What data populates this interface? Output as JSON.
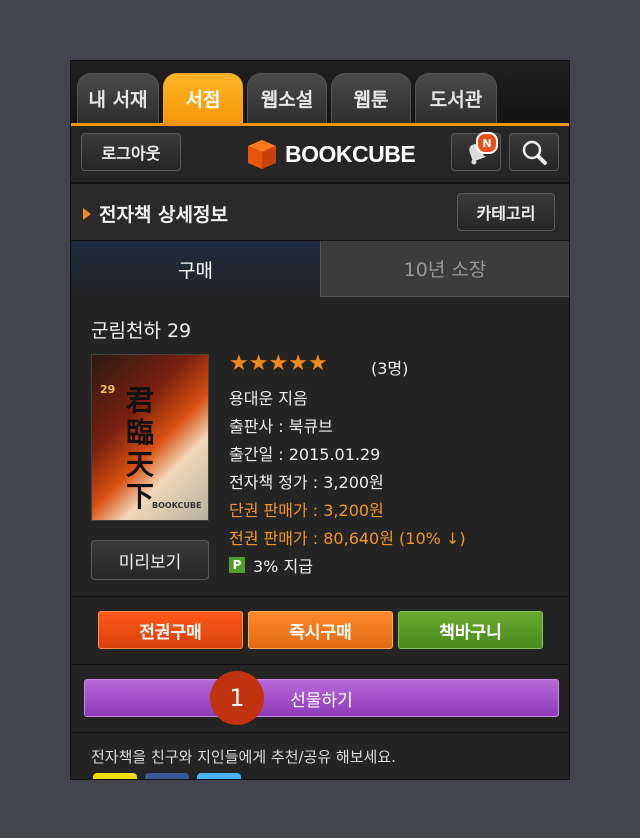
{
  "tabs": [
    {
      "label": "내 서재",
      "active": false
    },
    {
      "label": "서점",
      "active": true
    },
    {
      "label": "웹소설",
      "active": false
    },
    {
      "label": "웹툰",
      "active": false
    },
    {
      "label": "도서관",
      "active": false
    }
  ],
  "header": {
    "logout_label": "로그아웃",
    "logo_text": "BOOKCUBE",
    "notification_badge": "N"
  },
  "section": {
    "title": "전자책 상세정보",
    "category_label": "카테고리"
  },
  "purchase_tabs": [
    {
      "label": "구매",
      "active": true
    },
    {
      "label": "10년 소장",
      "active": false
    }
  ],
  "book": {
    "title": "군림천하 29",
    "rating_stars": 5,
    "rating_count": "(3명)",
    "author": "용대운 지음",
    "publisher": "출판사 : 북큐브",
    "release_date": "출간일 : 2015.01.29",
    "ebook_price": "전자책 정가 : 3,200원",
    "single_price": "단권 판매가 : 3,200원",
    "set_price": "전권 판매가 : 80,640원 (10% ↓)",
    "point_badge": "P",
    "point_text": "3% 지급",
    "preview_label": "미리보기",
    "cover_hanja": "君臨天下",
    "cover_vol": "29"
  },
  "actions": {
    "buy_all": "전권구매",
    "buy_now": "즉시구매",
    "cart": "책바구니",
    "gift": "선물하기"
  },
  "share_text": "전자책을 친구와 지인들에게 추천/공유 해보세요.",
  "marker": "1",
  "colors": {
    "accent": "#f59708",
    "buy_all": "#e84a0c",
    "buy_now": "#ef7a1a",
    "cart": "#5a9a2a",
    "gift": "#a050c8",
    "marker": "#c0330e"
  }
}
